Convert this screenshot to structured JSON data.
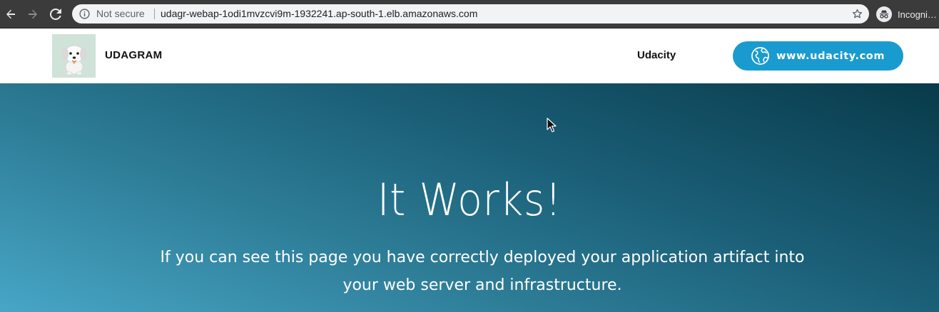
{
  "browser": {
    "security_label": "Not secure",
    "url": "udagr-webap-1odi1mvzcvi9m-1932241.ap-south-1.elb.amazonaws.com",
    "profile_label": "Incogni…",
    "icons": {
      "back": "back-arrow-icon",
      "forward": "forward-arrow-icon",
      "reload": "reload-icon",
      "info": "info-icon",
      "bookmark": "star-icon",
      "incognito": "incognito-icon"
    }
  },
  "header": {
    "brand": "UDAGRAM",
    "nav_link": "Udacity",
    "cta_label": "www.udacity.com",
    "cta_color": "#1a9bd0"
  },
  "hero": {
    "title": "It Works!",
    "text": "If you can see this page you have correctly deployed your application artifact into your web server and infrastructure."
  }
}
